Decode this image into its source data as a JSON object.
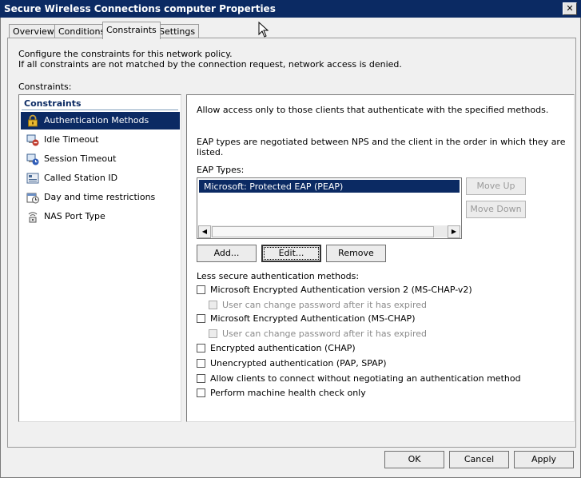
{
  "window": {
    "title": "Secure Wireless Connections computer Properties",
    "close_label": "✕"
  },
  "tabs": [
    {
      "label": "Overview"
    },
    {
      "label": "Conditions"
    },
    {
      "label": "Constraints"
    },
    {
      "label": "Settings"
    }
  ],
  "intro": {
    "line1": "Configure the constraints for this network policy.",
    "line2": "If all constraints are not matched by the connection request, network access is denied."
  },
  "constraints_label": "Constraints:",
  "constraints_list": {
    "header": "Constraints",
    "items": [
      {
        "label": "Authentication Methods",
        "icon": "lock-icon"
      },
      {
        "label": "Idle Timeout",
        "icon": "idle-timeout-icon"
      },
      {
        "label": "Session Timeout",
        "icon": "session-timeout-icon"
      },
      {
        "label": "Called Station ID",
        "icon": "called-station-icon"
      },
      {
        "label": "Day and time restrictions",
        "icon": "day-time-icon"
      },
      {
        "label": "NAS Port Type",
        "icon": "nas-port-icon"
      }
    ]
  },
  "auth": {
    "description": "Allow access only to those clients that authenticate with the specified methods.",
    "eap_note_line1": "EAP types are negotiated between NPS and the client in the order in which they are",
    "eap_note_line2": "listed.",
    "eap_types_label": "EAP Types:",
    "eap_types": [
      "Microsoft: Protected EAP (PEAP)"
    ],
    "move_up": "Move Up",
    "move_down": "Move Down",
    "add": "Add...",
    "edit": "Edit...",
    "remove": "Remove",
    "less_secure_label": "Less secure authentication methods:",
    "options": [
      {
        "label": "Microsoft Encrypted Authentication version 2 (MS-CHAP-v2)",
        "checked": false
      },
      {
        "label": "User can change password after it has expired",
        "checked": false,
        "disabled": true
      },
      {
        "label": "Microsoft Encrypted Authentication (MS-CHAP)",
        "checked": false
      },
      {
        "label": "User can change password after it has expired",
        "checked": false,
        "disabled": true
      },
      {
        "label": "Encrypted authentication (CHAP)",
        "checked": false
      },
      {
        "label": "Unencrypted authentication (PAP, SPAP)",
        "checked": false
      },
      {
        "label": "Allow clients to connect without negotiating an authentication method",
        "checked": false
      },
      {
        "label": "Perform machine health check only",
        "checked": false
      }
    ]
  },
  "footer": {
    "ok": "OK",
    "cancel": "Cancel",
    "apply": "Apply"
  },
  "colors": {
    "title_bar": "#0b2a63",
    "selection": "#0b2a63",
    "dialog_bg": "#f0f0f0"
  }
}
